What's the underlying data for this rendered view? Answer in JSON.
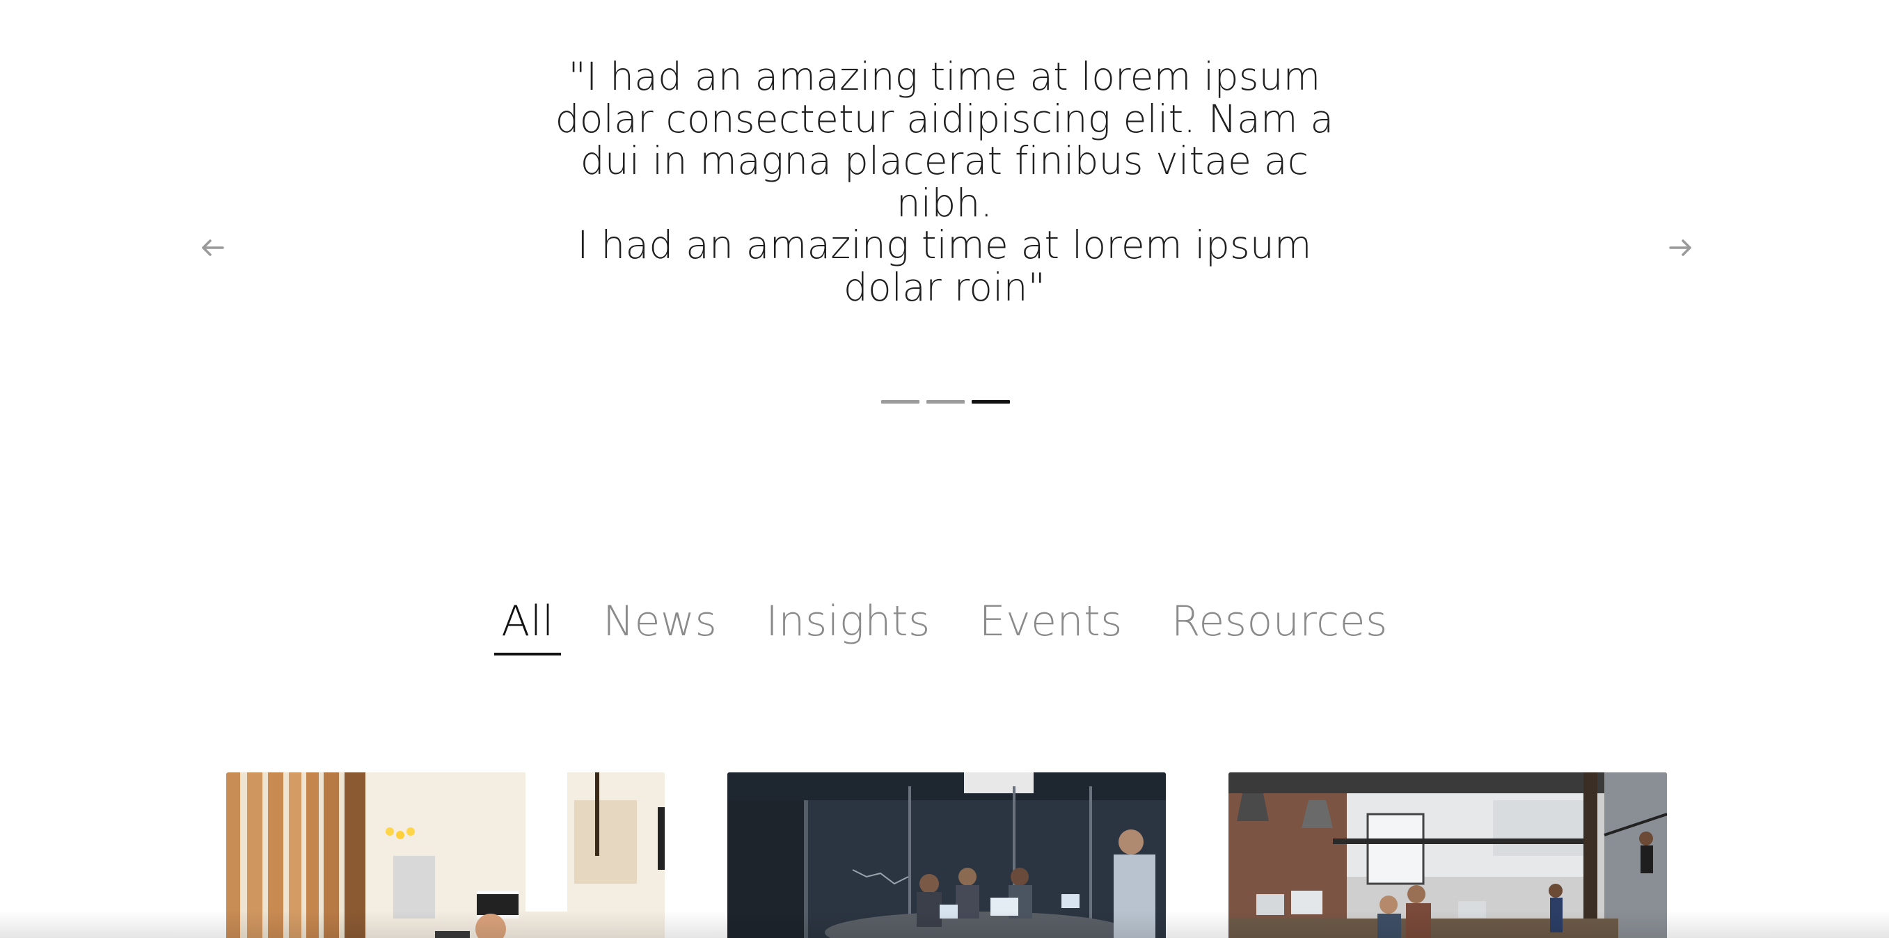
{
  "testimonial": {
    "lines": [
      "\"I had an amazing time at lorem ipsum",
      "dolar consectetur aidipiscing elit. Nam a",
      "dui in magna placerat finibus vitae ac nibh.",
      "I had an amazing time at lorem ipsum",
      "dolar roin\""
    ]
  },
  "carousel": {
    "prev_icon": "arrow-left-icon",
    "next_icon": "arrow-right-icon",
    "slide_count": 3,
    "active_slide": 3
  },
  "tabs": [
    {
      "label": "All",
      "active": true
    },
    {
      "label": "News",
      "active": false
    },
    {
      "label": "Insights",
      "active": false
    },
    {
      "label": "Events",
      "active": false
    },
    {
      "label": "Resources",
      "active": false
    }
  ],
  "cards": [
    {
      "image": "bright office with wooden slats and person at computer"
    },
    {
      "image": "dark glass meeting room with team at laptops"
    },
    {
      "image": "industrial loft office with brick wall and staircase"
    }
  ],
  "colors": {
    "text_dark": "#202020",
    "text_muted": "#8a8a8a",
    "arrow": "#9a9a9a",
    "dot_inactive": "#9b9b9b",
    "dot_active": "#111111"
  }
}
